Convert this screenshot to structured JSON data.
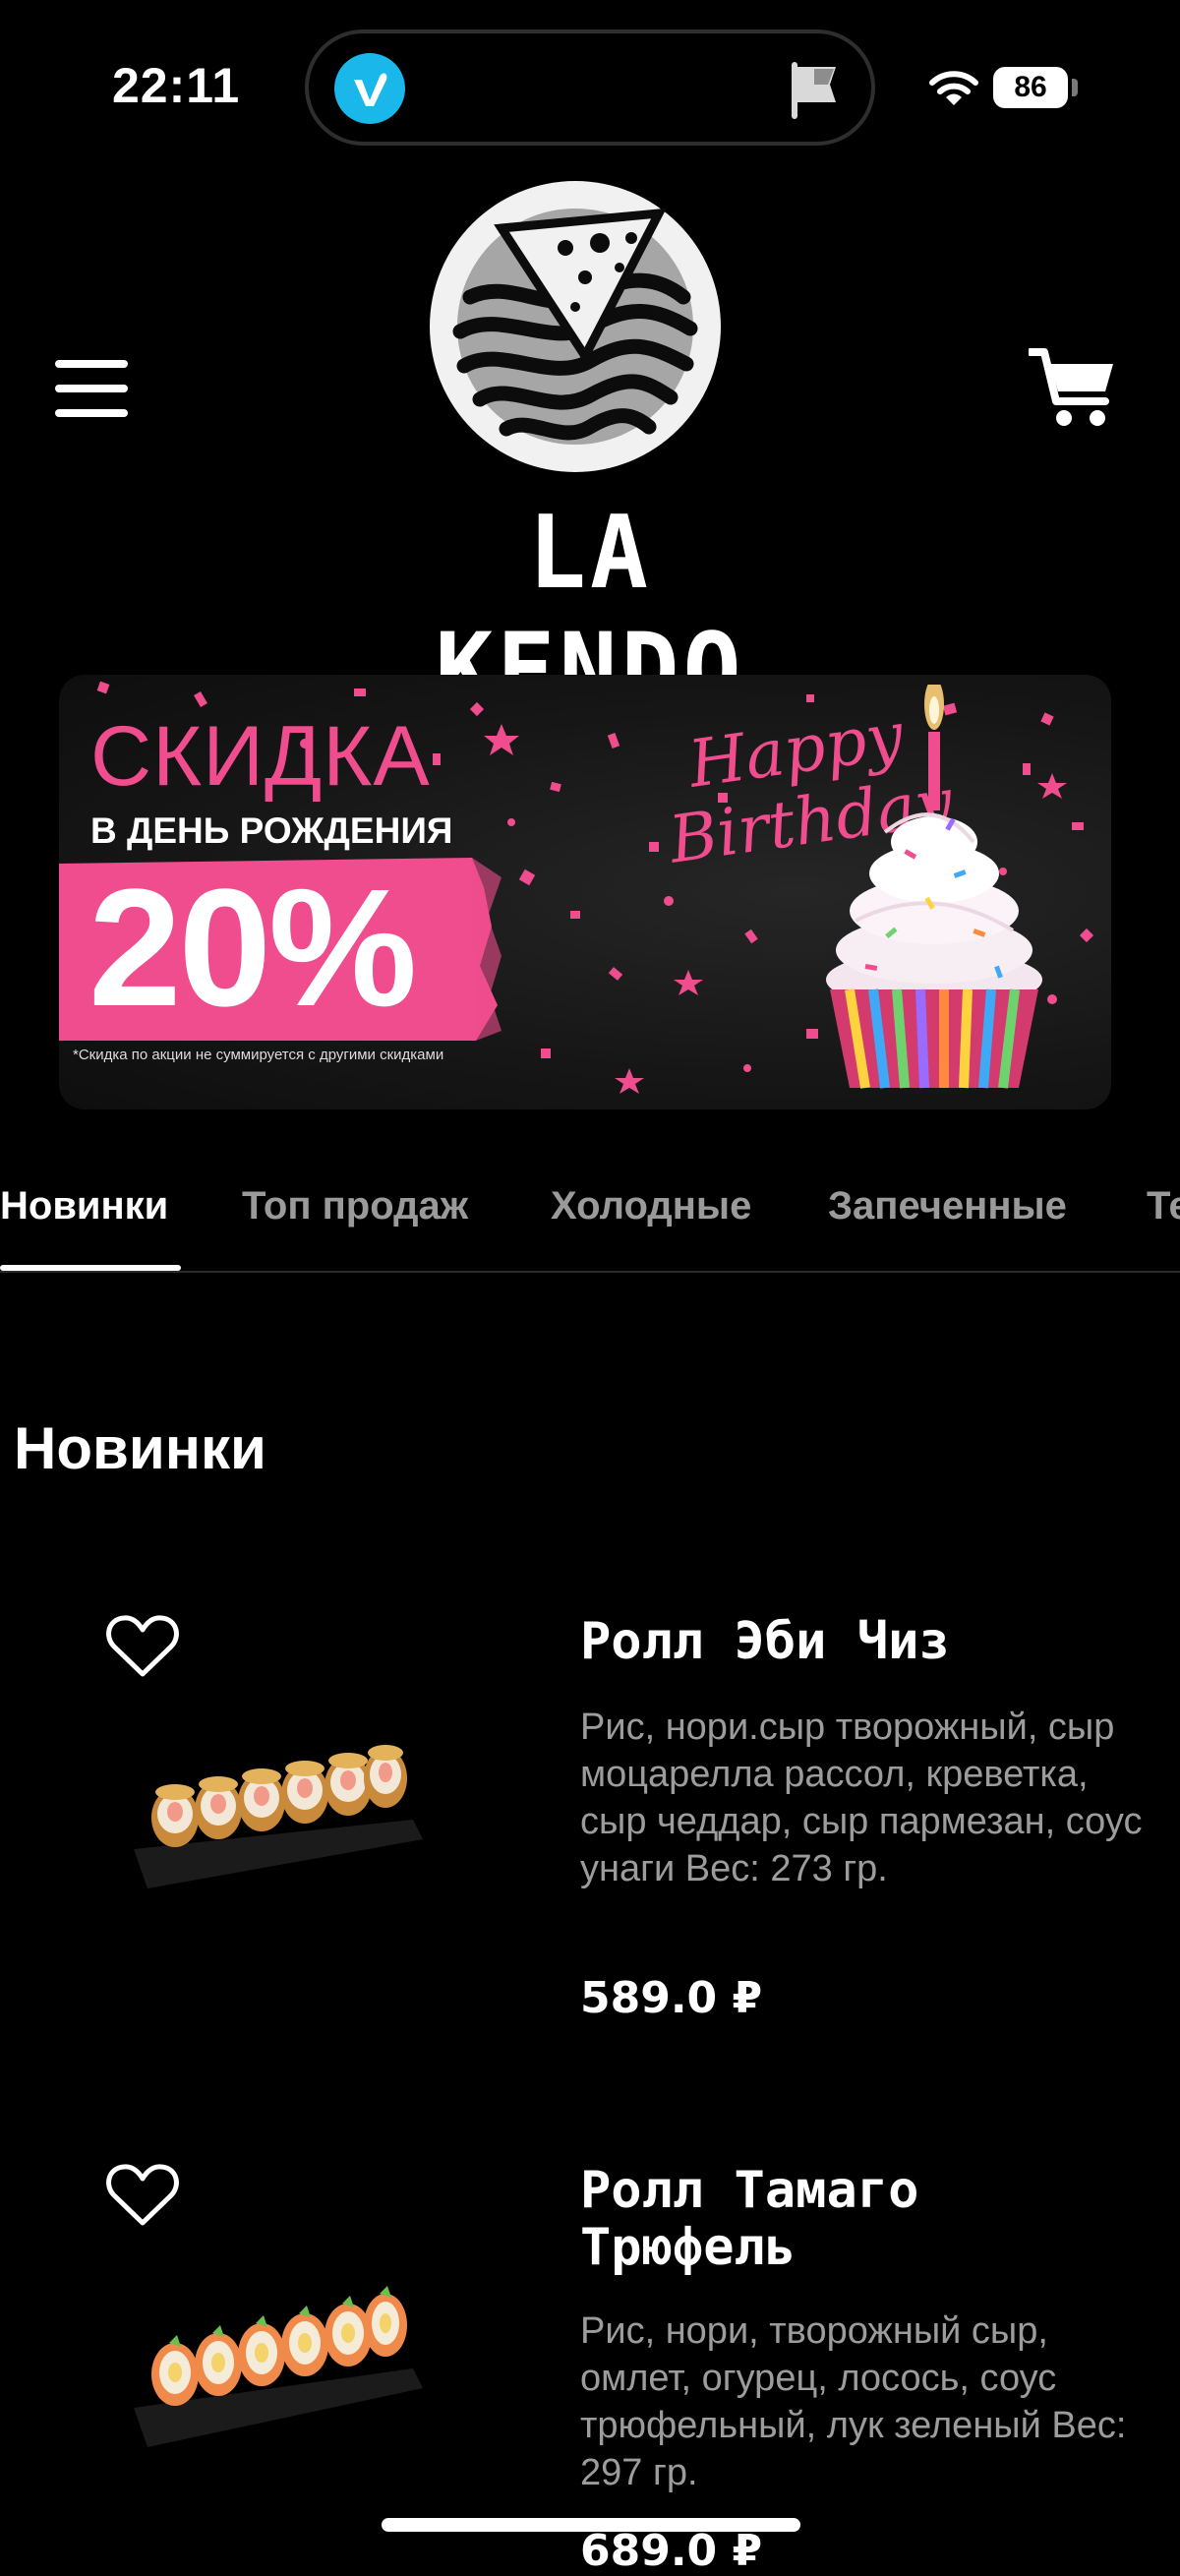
{
  "status_bar": {
    "time": "22:11",
    "battery": "86",
    "icons": [
      "vimeo-icon",
      "flag-icon",
      "wifi-icon",
      "battery-icon"
    ]
  },
  "header": {
    "brand": "LA KENDO",
    "icons": [
      "hamburger-menu-icon",
      "cart-icon"
    ]
  },
  "banner": {
    "title": "СКИДКА",
    "subtitle": "В ДЕНЬ РОЖДЕНИЯ",
    "percent": "20%",
    "footnote": "*Скидка по акции не суммируется с другими скидками",
    "happy": "Happy",
    "birthday": "Birthday",
    "colors": {
      "accent": "#ef4d8e",
      "background": "#161616"
    }
  },
  "tabs": [
    {
      "label": "Новинки",
      "active": true
    },
    {
      "label": "Топ продаж",
      "active": false
    },
    {
      "label": "Холодные",
      "active": false
    },
    {
      "label": "Запеченные",
      "active": false
    },
    {
      "label": "Те",
      "active": false
    }
  ],
  "section": {
    "title": "Новинки"
  },
  "products": [
    {
      "name": "Ролл Эби Чиз",
      "description": "Рис, нори.сыр творожный, сыр моцарелла рассол, креветка, сыр чеддар, сыр пармезан, соус унаги Вес: 273 гр.",
      "price": "589.0 ₽"
    },
    {
      "name": "Ролл Тамаго Трюфель",
      "description": "Рис, нори, творожный сыр, омлет, огурец, лосось, соус трюфельный, лук зеленый Вес: 297 гр.",
      "price": "689.0 ₽"
    }
  ]
}
